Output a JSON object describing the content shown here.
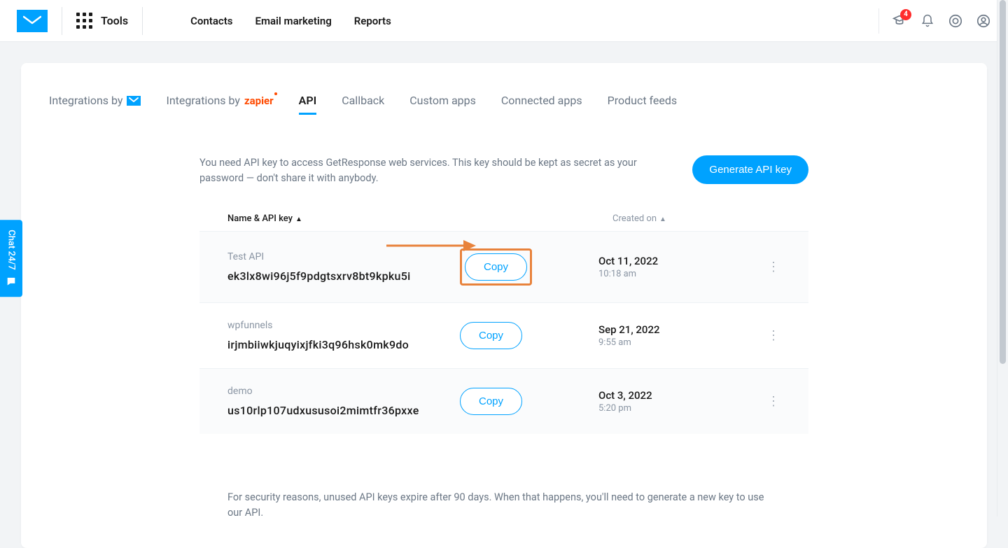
{
  "topbar": {
    "tools_label": "Tools",
    "nav": [
      "Contacts",
      "Email marketing",
      "Reports"
    ],
    "badge_count": "4"
  },
  "tabs": {
    "integrations_by": "Integrations by",
    "zapier": "zapier",
    "items": [
      "API",
      "Callback",
      "Custom apps",
      "Connected apps",
      "Product feeds"
    ],
    "active_index": 0
  },
  "header": {
    "description": "You need API key to access GetResponse web services. This key should be kept as secret as your password — don't share it with anybody.",
    "generate_label": "Generate API key"
  },
  "list": {
    "col_name": "Name & API key",
    "col_date": "Created on",
    "copy_label": "Copy",
    "rows": [
      {
        "name": "Test API",
        "key": "ek3lx8wi96j5f9pdgtsxrv8bt9kpku5i",
        "date": "Oct 11, 2022",
        "time": "10:18 am",
        "highlighted": true
      },
      {
        "name": "wpfunnels",
        "key": "irjmbiiwkjuqyixjfki3q96hsk0mk9do",
        "date": "Sep 21, 2022",
        "time": "9:55 am",
        "highlighted": false
      },
      {
        "name": "demo",
        "key": "us10rlp107udxususoi2mimtfr36pxxe",
        "date": "Oct 3, 2022",
        "time": "5:20 pm",
        "highlighted": false
      }
    ]
  },
  "footnote": "For security reasons, unused API keys expire after 90 days. When that happens, you'll need to generate a new key to use our API.",
  "chat": {
    "label": "Chat 24/7"
  }
}
